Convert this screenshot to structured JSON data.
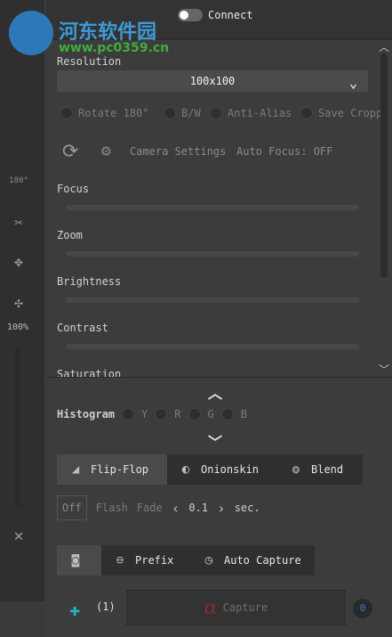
{
  "watermark": {
    "title": "河东软件园",
    "url": "www.pc0359.cn"
  },
  "connect": {
    "label": "Connect"
  },
  "resolution": {
    "label": "Resolution",
    "value": "100x100"
  },
  "options": [
    "Rotate 180°",
    "B/W",
    "Anti-Alias",
    "Save Cropp"
  ],
  "camera": {
    "settings_label": "Camera Settings",
    "autofocus": "Auto Focus: OFF"
  },
  "sliders": [
    "Focus",
    "Zoom",
    "Brightness",
    "Contrast",
    "Saturation"
  ],
  "rail": {
    "zoom_percent": "100%",
    "rotate_badge": "180°"
  },
  "histogram": {
    "label": "Histogram",
    "channels": [
      "Y",
      "R",
      "G",
      "B"
    ]
  },
  "blend_tabs": [
    "Flip-Flop",
    "Onionskin",
    "Blend"
  ],
  "flipflop": {
    "off": "Off",
    "flash": "Flash",
    "fade": "Fade",
    "value": "0.1",
    "unit": "sec."
  },
  "capture_tabs": [
    "Prefix",
    "Auto Capture"
  ],
  "capture": {
    "count": "(1)",
    "label": "Capture",
    "badge": "0",
    "logo_char": "α"
  }
}
